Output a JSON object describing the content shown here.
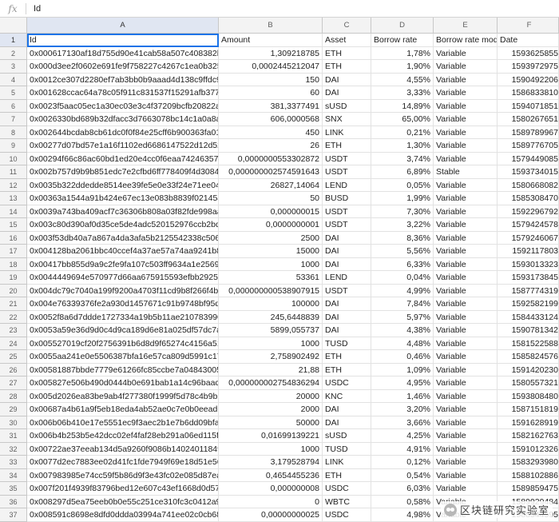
{
  "formula_bar": {
    "icon": "fx",
    "value": "Id"
  },
  "columns": [
    "A",
    "B",
    "C",
    "D",
    "E",
    "F"
  ],
  "table": {
    "headers": [
      "Id",
      "Amount",
      "Asset",
      "Borrow rate",
      "Borrow rate mod",
      "Date"
    ],
    "rows": [
      [
        "0x000617130af18d755d90e41cab58a507c408382b5",
        "1,309218785",
        "ETH",
        "1,78%",
        "Variable",
        "1593625855"
      ],
      [
        "0x000d3ee2f0602e691fe9f758227c4267c1ea0b325b",
        "0,0002445212047",
        "ETH",
        "1,90%",
        "Variable",
        "1593972975"
      ],
      [
        "0x0012ce307d2280ef7ab3bb0b9aaad4d138c9ffdc9a",
        "150",
        "DAI",
        "4,55%",
        "Variable",
        "1590492206"
      ],
      [
        "0x001628ccac64a78c05f911c831537f15291afb377d",
        "60",
        "DAI",
        "3,33%",
        "Variable",
        "1586833810"
      ],
      [
        "0x0023f5aac05ec1a30ec03e3c4f37209bcfb20822ae",
        "381,3377491",
        "sUSD",
        "14,89%",
        "Variable",
        "1594071851"
      ],
      [
        "0x0026330bd689b32dfacc3d7663078bc14c1a0a8a4",
        "606,0000568",
        "SNX",
        "65,00%",
        "Variable",
        "1580267651"
      ],
      [
        "0x002644bcdab8cb61dc0f0f84e25cff6b900363fa01e",
        "450",
        "LINK",
        "0,21%",
        "Variable",
        "1589789967"
      ],
      [
        "0x00277d07bd57e1a16f1102ed6686147522d12d52f",
        "26",
        "ETH",
        "1,30%",
        "Variable",
        "1589776705"
      ],
      [
        "0x00294f66c86ac60bd1ed20e4cc0f6eaa742463578",
        "0,0000000553302872",
        "USDT",
        "3,74%",
        "Variable",
        "1579449085"
      ],
      [
        "0x002b757d9b9b851edc7e2cfbd6ff778409f4d3084e",
        "0,000000002574591643",
        "USDT",
        "6,89%",
        "Stable",
        "1593734015"
      ],
      [
        "0x0035b322ddedde8514ee39fe5e0e33f24e71ee04d",
        "26827,14064",
        "LEND",
        "0,05%",
        "Variable",
        "1580668082"
      ],
      [
        "0x00363a1544a91b424e67ec13e083b8839f021454a",
        "50",
        "BUSD",
        "1,99%",
        "Variable",
        "1585308470"
      ],
      [
        "0x0039a743ba409acf7c36306b808a03f82fde998aa",
        "0,000000015",
        "USDT",
        "7,30%",
        "Variable",
        "1592296792"
      ],
      [
        "0x003c80d390af0d35ce5de4adc520152976ccb2bd5",
        "0,0000000001",
        "USDT",
        "3,22%",
        "Variable",
        "1579424578"
      ],
      [
        "0x003f53db40a7a867a4da3afa5b2125542338c5069",
        "2500",
        "DAI",
        "8,36%",
        "Variable",
        "1579246067"
      ],
      [
        "0x004128ba2061bbc40ccef4a37ae57a74aa9241b83",
        "15000",
        "DAI",
        "5,56%",
        "Variable",
        "1592117803"
      ],
      [
        "0x00417bb855d9a9c2fe9fa107c503ff9634a1e2569a",
        "1000",
        "DAI",
        "6,33%",
        "Variable",
        "1593013323"
      ],
      [
        "0x0044449694e570977d66aa675915593efbb292534",
        "53361",
        "LEND",
        "0,04%",
        "Variable",
        "1593173845"
      ],
      [
        "0x004dc79c7040a199f9200a4703f11cd9b8f266f4b2",
        "0,000000000538907915",
        "USDT",
        "4,99%",
        "Variable",
        "1587774319"
      ],
      [
        "0x004e76339376fe2a930d1457671c91b9748bf95dd",
        "100000",
        "DAI",
        "7,84%",
        "Variable",
        "1592582199"
      ],
      [
        "0x0052f8a6d7ddde1727334a19b5b11ae210783990f",
        "245,6448839",
        "DAI",
        "5,97%",
        "Variable",
        "1584433124"
      ],
      [
        "0x0053a59e36d9d0c4d9ca189d6e81a025df57dc7a0",
        "5899,055737",
        "DAI",
        "4,38%",
        "Variable",
        "1590781342"
      ],
      [
        "0x005527019cf20f2756391b6d8d9f65274c4156a510",
        "1000",
        "TUSD",
        "4,48%",
        "Variable",
        "1581522588"
      ],
      [
        "0x0055aa241e0e5506387bfa16e57ca809d5991c179",
        "2,758902492",
        "ETH",
        "0,46%",
        "Variable",
        "1585824576"
      ],
      [
        "0x00581887bbde7779e61266fc85ccbe7a04843005f",
        "21,88",
        "ETH",
        "1,09%",
        "Variable",
        "1591420230"
      ],
      [
        "0x005827e506b490d0444b0e691bab1a14c96baac8",
        "0,000000002754836294",
        "USDC",
        "4,95%",
        "Variable",
        "1580557321"
      ],
      [
        "0x005d2026ea83be9ab4f277380f1999f5d78c4b9b24",
        "20000",
        "KNC",
        "1,46%",
        "Variable",
        "1593808480"
      ],
      [
        "0x00687a4b61a9f5eb18eda4ab52ae0c7e0b0eead62",
        "2000",
        "DAI",
        "3,20%",
        "Variable",
        "1587151819"
      ],
      [
        "0x006b06b410e17e5551ec9f3aec2b1e7b6dd09bfa5",
        "50000",
        "DAI",
        "3,66%",
        "Variable",
        "1591628919"
      ],
      [
        "0x006b4b253b5e42dcc02ef4faf28eb291a06ed115f3",
        "0,01699139221",
        "sUSD",
        "4,25%",
        "Variable",
        "1582162763"
      ],
      [
        "0x00722ae37eeab134d5a9260f9086b14024011849a",
        "1000",
        "TUSD",
        "4,91%",
        "Variable",
        "1591012326"
      ],
      [
        "0x0077d2ec7883ee02d41fc1fde7949f69e18d51e56c",
        "3,179528794",
        "LINK",
        "0,12%",
        "Variable",
        "1583293980"
      ],
      [
        "0x007983985e74cc59f5b86d9f3e43fc02e085d87ea8",
        "0,4654455236",
        "ETH",
        "0,54%",
        "Variable",
        "1588102886"
      ],
      [
        "0x007f201f4939f83796bed12e607c43ef1668d0d57e",
        "0,000000008",
        "USDC",
        "6,03%",
        "Variable",
        "1589859475"
      ],
      [
        "0x008297d5ea75eeb0b0e55c251ce310fc3c0412a98",
        "0",
        "WBTC",
        "0,58%",
        "Variable",
        "1589929484"
      ],
      [
        "0x008591c8698e8dfd0ddda03994a741ee02c0cb68f",
        "0,00000000025",
        "USDC",
        "4,98%",
        "Variable",
        "1588544595"
      ]
    ]
  },
  "watermark": {
    "text": "区块链研究实验室"
  }
}
